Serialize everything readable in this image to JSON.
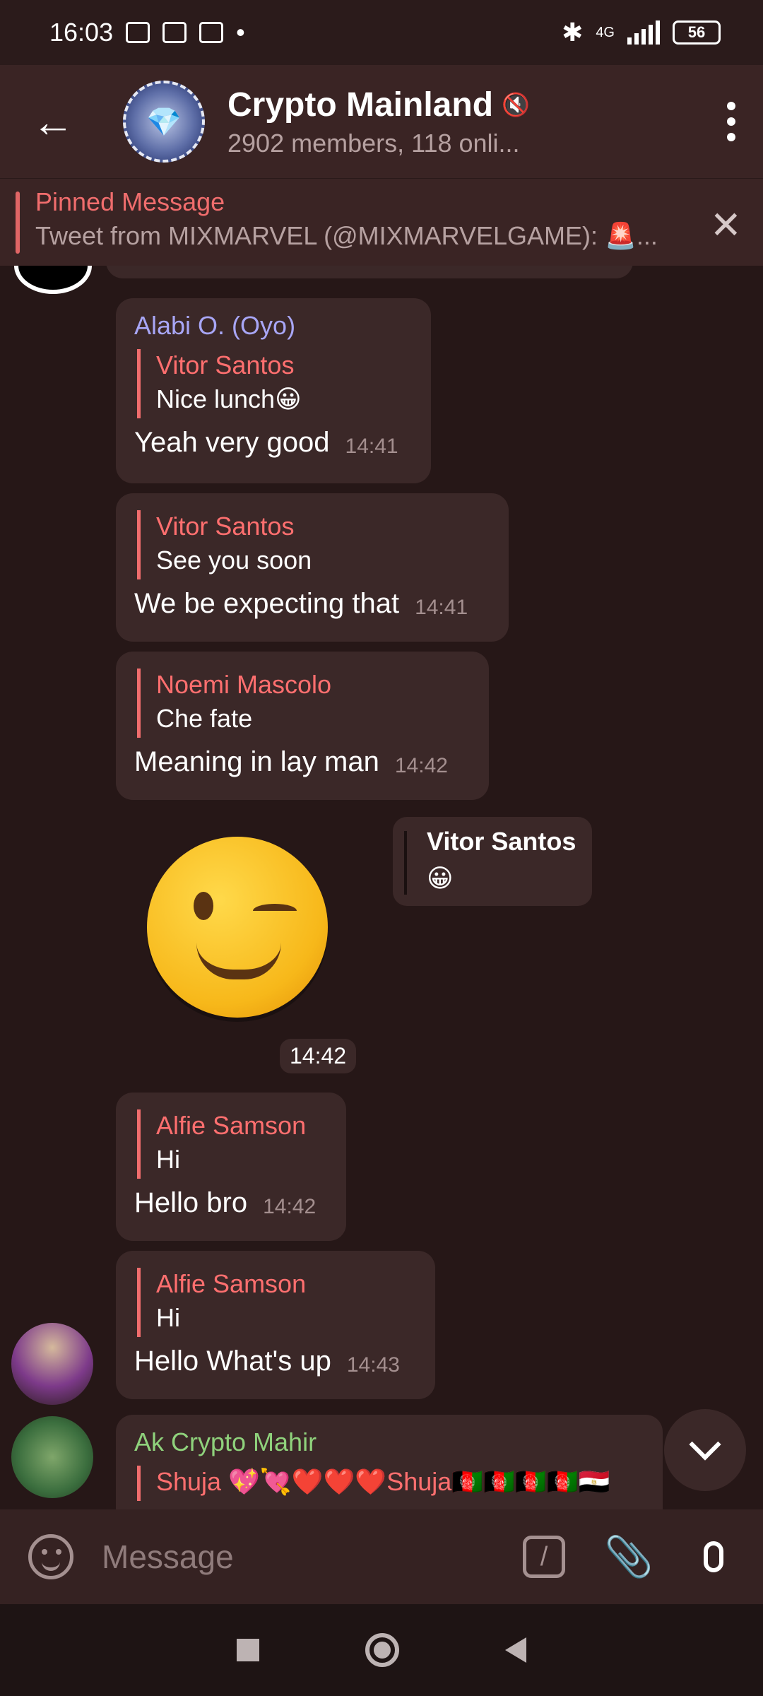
{
  "status_bar": {
    "time": "16:03",
    "network": "4G",
    "battery": "56"
  },
  "header": {
    "title": "Crypto Mainland",
    "subtitle": "2902 members, 118 onli...",
    "muted_icon": "muted-speaker-icon",
    "back_icon": "arrow-left-icon",
    "menu_icon": "more-vertical-icon"
  },
  "pinned": {
    "label": "Pinned Message",
    "text": "Tweet from MIXMARVEL (@MIXMARVELGAME): 🚨..."
  },
  "messages": [
    {
      "sender": "Alabi O. (Oyo)",
      "sender_color": "#a8a6f6",
      "reply_name": "Vitor Santos",
      "reply_text": "Nice lunch😀",
      "text": "Yeah very good",
      "time": "14:41"
    },
    {
      "reply_name": "Vitor Santos",
      "reply_text": "See you soon",
      "text": "We be expecting that",
      "time": "14:41"
    },
    {
      "reply_name": "Noemi Mascolo",
      "reply_text": "Che fate",
      "text": "Meaning in lay man",
      "time": "14:42"
    },
    {
      "reply_name": "Alfie Samson",
      "reply_text": "Hi",
      "text": "Hello bro",
      "time": "14:42"
    },
    {
      "reply_name": "Alfie Samson",
      "reply_text": "Hi",
      "text": "Hello What's up",
      "time": "14:43"
    },
    {
      "sender": "Ak Crypto Mahir",
      "sender_color": "#8fd27c",
      "reply_name": "Shuja 💖💘❤️❤️❤️Shuja🇦🇫🇦🇫🇦🇫🇦🇫🇪🇬",
      "reply_text": ""
    }
  ],
  "sticker": {
    "emoji_name": "winking-face",
    "time": "14:42",
    "reply_to_name": "Vitor Santos",
    "reply_to_text": "😀"
  },
  "input": {
    "placeholder": "Message"
  },
  "colors": {
    "background": "#261717",
    "header": "#3a2424",
    "bubble": "#3b2828",
    "reply_accent": "#f06d6d"
  }
}
